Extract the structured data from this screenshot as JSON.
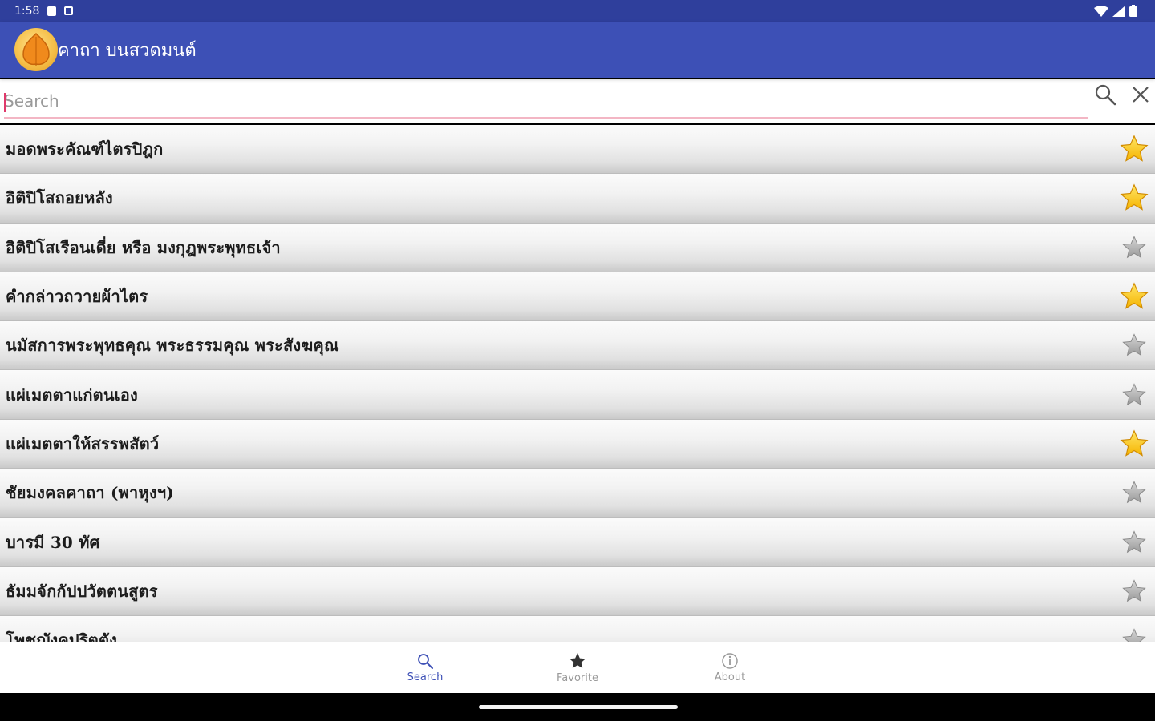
{
  "status": {
    "time": "1:58"
  },
  "app": {
    "title": "คาถา บนสวดมนต์"
  },
  "search": {
    "placeholder": "Search",
    "value": ""
  },
  "items": [
    {
      "label": "มอดพระคัณฑ์ไตรปิฎก",
      "favorite": true
    },
    {
      "label": "อิติปิโสถอยหลัง",
      "favorite": true
    },
    {
      "label": "อิติปิโสเรือนเดี่ย หรือ มงกุฎพระพุทธเจ้า",
      "favorite": false
    },
    {
      "label": "คำกล่าวถวายผ้าไตร",
      "favorite": true
    },
    {
      "label": "นมัสการพระพุทธคุณ พระธรรมคุณ พระสังฆคุณ",
      "favorite": false
    },
    {
      "label": "แผ่เมตตาแก่ตนเอง",
      "favorite": false
    },
    {
      "label": "แผ่เมตตาให้สรรพสัตว์",
      "favorite": true
    },
    {
      "label": "ชัยมงคลคาถา (พาหุงฯ)",
      "favorite": false
    },
    {
      "label": "บารมี 30 ทัศ",
      "favorite": false
    },
    {
      "label": "ธัมมจักกัปปวัตตนสูตร",
      "favorite": false
    },
    {
      "label": "โพชฌังคปริตตัง",
      "favorite": false
    }
  ],
  "nav": [
    {
      "label": "Search",
      "icon": "search-icon",
      "active": true
    },
    {
      "label": "Favorite",
      "icon": "star-icon",
      "active": false
    },
    {
      "label": "About",
      "icon": "info-icon",
      "active": false
    }
  ],
  "colors": {
    "app_bar": "#3d50b6",
    "status_bar": "#2f3f9c",
    "accent_pink": "#f3b6c4",
    "favorite_star": "#f5b400",
    "inactive_star": "#9a9a9a"
  }
}
